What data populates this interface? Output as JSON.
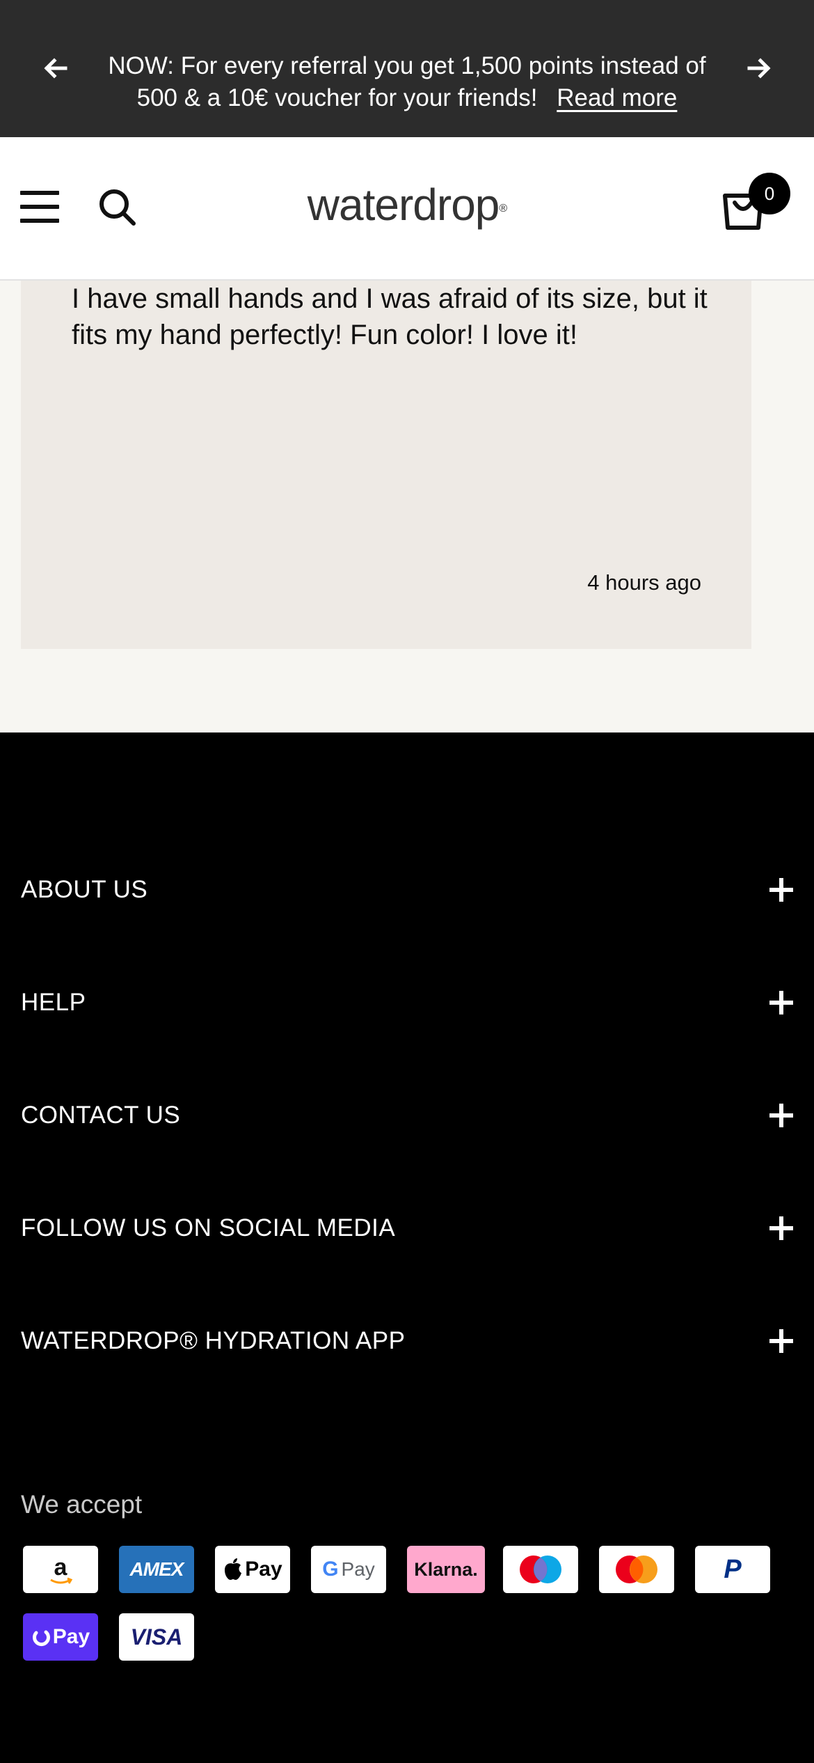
{
  "announcement": {
    "message": "NOW: For every referral you get 1,500 points instead of 500 & a 10€ voucher for your friends!",
    "link_label": "Read more"
  },
  "header": {
    "logo_text": "waterdrop",
    "cart_count": "0"
  },
  "review": {
    "text": "I have small hands and I was afraid of its size, but it fits my hand perfectly! Fun color! I love it!",
    "time": "4 hours ago"
  },
  "footer": {
    "sections": [
      {
        "label": "ABOUT US"
      },
      {
        "label": "HELP"
      },
      {
        "label": "CONTACT US"
      },
      {
        "label": "FOLLOW US ON SOCIAL MEDIA"
      },
      {
        "label": "WATERDROP® HYDRATION APP"
      }
    ],
    "we_accept_label": "We accept",
    "payment_methods": [
      {
        "name": "Amazon Pay",
        "icon": "amazon-icon",
        "text": "a"
      },
      {
        "name": "American Express",
        "icon": "amex-icon",
        "text": "AMEX"
      },
      {
        "name": "Apple Pay",
        "icon": "apple-pay-icon",
        "text": "Pay"
      },
      {
        "name": "Google Pay",
        "icon": "google-pay-icon",
        "text": "Pay"
      },
      {
        "name": "Klarna",
        "icon": "klarna-icon",
        "text": "Klarna."
      },
      {
        "name": "Maestro",
        "icon": "maestro-icon"
      },
      {
        "name": "Mastercard",
        "icon": "mastercard-icon"
      },
      {
        "name": "PayPal",
        "icon": "paypal-icon",
        "text": "P"
      },
      {
        "name": "Shop Pay",
        "icon": "shop-pay-icon",
        "text": "Pay"
      },
      {
        "name": "Visa",
        "icon": "visa-icon",
        "text": "VISA"
      }
    ]
  },
  "colors": {
    "announcement_bg": "#2c2c2c",
    "review_bg": "#eeeae5",
    "page_bg": "#f7f6f2",
    "footer_bg": "#000000",
    "klarna_pink": "#ffa8cd",
    "shop_pay_purple": "#5a31f4"
  }
}
